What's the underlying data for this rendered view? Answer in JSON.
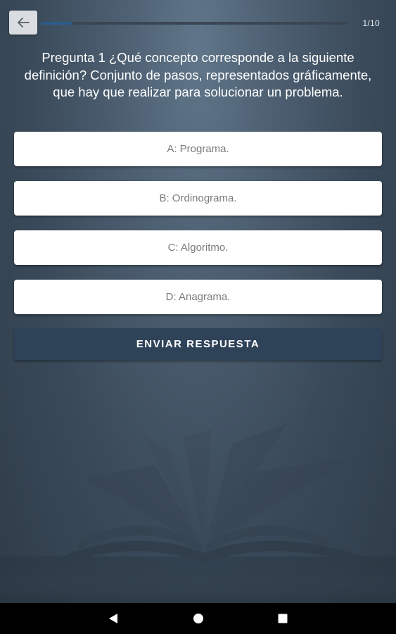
{
  "header": {
    "back_icon": "arrow-left-icon",
    "progress": {
      "current": 1,
      "total": 10,
      "label": "1/10",
      "fill_fraction": 0.1
    }
  },
  "question": {
    "text": "Pregunta 1 ¿Qué concepto corresponde a la siguiente definición? Conjunto de pasos, representados gráficamente, que hay que realizar para solucionar un problema."
  },
  "answers": [
    {
      "label": "A: Programa."
    },
    {
      "label": "B: Ordinograma."
    },
    {
      "label": "C: Algoritmo."
    },
    {
      "label": "D: Anagrama."
    }
  ],
  "submit": {
    "label": "ENVIAR RESPUESTA"
  },
  "system_nav": {
    "back_icon": "triangle-back-icon",
    "home_icon": "circle-home-icon",
    "recents_icon": "square-recents-icon"
  },
  "colors": {
    "accent": "#2e4258",
    "progress_fill": "#2c5c8c",
    "answer_text": "#7b7b7b"
  }
}
